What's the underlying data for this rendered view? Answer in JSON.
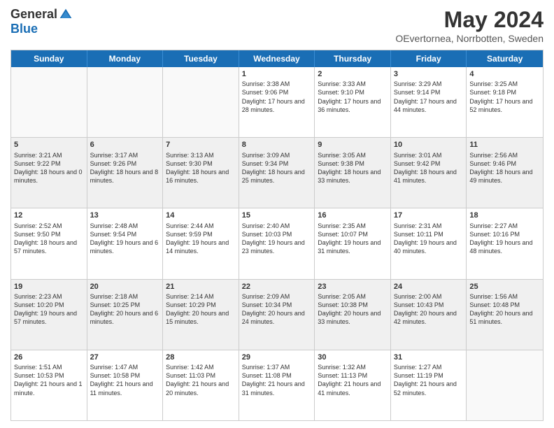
{
  "logo": {
    "general": "General",
    "blue": "Blue"
  },
  "title": "May 2024",
  "subtitle": "OEvertornea, Norrbotten, Sweden",
  "days_of_week": [
    "Sunday",
    "Monday",
    "Tuesday",
    "Wednesday",
    "Thursday",
    "Friday",
    "Saturday"
  ],
  "weeks": [
    [
      {
        "day": "",
        "info": ""
      },
      {
        "day": "",
        "info": ""
      },
      {
        "day": "",
        "info": ""
      },
      {
        "day": "1",
        "info": "Sunrise: 3:38 AM\nSunset: 9:06 PM\nDaylight: 17 hours and 28 minutes."
      },
      {
        "day": "2",
        "info": "Sunrise: 3:33 AM\nSunset: 9:10 PM\nDaylight: 17 hours and 36 minutes."
      },
      {
        "day": "3",
        "info": "Sunrise: 3:29 AM\nSunset: 9:14 PM\nDaylight: 17 hours and 44 minutes."
      },
      {
        "day": "4",
        "info": "Sunrise: 3:25 AM\nSunset: 9:18 PM\nDaylight: 17 hours and 52 minutes."
      }
    ],
    [
      {
        "day": "5",
        "info": "Sunrise: 3:21 AM\nSunset: 9:22 PM\nDaylight: 18 hours and 0 minutes."
      },
      {
        "day": "6",
        "info": "Sunrise: 3:17 AM\nSunset: 9:26 PM\nDaylight: 18 hours and 8 minutes."
      },
      {
        "day": "7",
        "info": "Sunrise: 3:13 AM\nSunset: 9:30 PM\nDaylight: 18 hours and 16 minutes."
      },
      {
        "day": "8",
        "info": "Sunrise: 3:09 AM\nSunset: 9:34 PM\nDaylight: 18 hours and 25 minutes."
      },
      {
        "day": "9",
        "info": "Sunrise: 3:05 AM\nSunset: 9:38 PM\nDaylight: 18 hours and 33 minutes."
      },
      {
        "day": "10",
        "info": "Sunrise: 3:01 AM\nSunset: 9:42 PM\nDaylight: 18 hours and 41 minutes."
      },
      {
        "day": "11",
        "info": "Sunrise: 2:56 AM\nSunset: 9:46 PM\nDaylight: 18 hours and 49 minutes."
      }
    ],
    [
      {
        "day": "12",
        "info": "Sunrise: 2:52 AM\nSunset: 9:50 PM\nDaylight: 18 hours and 57 minutes."
      },
      {
        "day": "13",
        "info": "Sunrise: 2:48 AM\nSunset: 9:54 PM\nDaylight: 19 hours and 6 minutes."
      },
      {
        "day": "14",
        "info": "Sunrise: 2:44 AM\nSunset: 9:59 PM\nDaylight: 19 hours and 14 minutes."
      },
      {
        "day": "15",
        "info": "Sunrise: 2:40 AM\nSunset: 10:03 PM\nDaylight: 19 hours and 23 minutes."
      },
      {
        "day": "16",
        "info": "Sunrise: 2:35 AM\nSunset: 10:07 PM\nDaylight: 19 hours and 31 minutes."
      },
      {
        "day": "17",
        "info": "Sunrise: 2:31 AM\nSunset: 10:11 PM\nDaylight: 19 hours and 40 minutes."
      },
      {
        "day": "18",
        "info": "Sunrise: 2:27 AM\nSunset: 10:16 PM\nDaylight: 19 hours and 48 minutes."
      }
    ],
    [
      {
        "day": "19",
        "info": "Sunrise: 2:23 AM\nSunset: 10:20 PM\nDaylight: 19 hours and 57 minutes."
      },
      {
        "day": "20",
        "info": "Sunrise: 2:18 AM\nSunset: 10:25 PM\nDaylight: 20 hours and 6 minutes."
      },
      {
        "day": "21",
        "info": "Sunrise: 2:14 AM\nSunset: 10:29 PM\nDaylight: 20 hours and 15 minutes."
      },
      {
        "day": "22",
        "info": "Sunrise: 2:09 AM\nSunset: 10:34 PM\nDaylight: 20 hours and 24 minutes."
      },
      {
        "day": "23",
        "info": "Sunrise: 2:05 AM\nSunset: 10:38 PM\nDaylight: 20 hours and 33 minutes."
      },
      {
        "day": "24",
        "info": "Sunrise: 2:00 AM\nSunset: 10:43 PM\nDaylight: 20 hours and 42 minutes."
      },
      {
        "day": "25",
        "info": "Sunrise: 1:56 AM\nSunset: 10:48 PM\nDaylight: 20 hours and 51 minutes."
      }
    ],
    [
      {
        "day": "26",
        "info": "Sunrise: 1:51 AM\nSunset: 10:53 PM\nDaylight: 21 hours and 1 minute."
      },
      {
        "day": "27",
        "info": "Sunrise: 1:47 AM\nSunset: 10:58 PM\nDaylight: 21 hours and 11 minutes."
      },
      {
        "day": "28",
        "info": "Sunrise: 1:42 AM\nSunset: 11:03 PM\nDaylight: 21 hours and 20 minutes."
      },
      {
        "day": "29",
        "info": "Sunrise: 1:37 AM\nSunset: 11:08 PM\nDaylight: 21 hours and 31 minutes."
      },
      {
        "day": "30",
        "info": "Sunrise: 1:32 AM\nSunset: 11:13 PM\nDaylight: 21 hours and 41 minutes."
      },
      {
        "day": "31",
        "info": "Sunrise: 1:27 AM\nSunset: 11:19 PM\nDaylight: 21 hours and 52 minutes."
      },
      {
        "day": "",
        "info": ""
      }
    ]
  ]
}
